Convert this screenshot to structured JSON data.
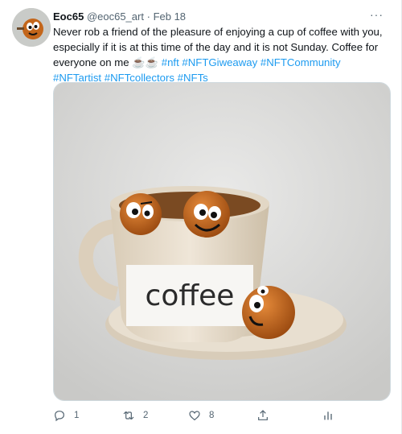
{
  "tweet": {
    "display_name": "Eoc65",
    "handle": "@eoc65_art",
    "separator": "·",
    "date": "Feb 18",
    "more_label": "···",
    "text_part1": "Never rob a friend of the pleasure of enjoying a cup of coffee with you, especially if it is at this time of the day and it is not Sunday. Coffee for everyone on me ",
    "emoji": "☕☕",
    "hashtags": [
      "#nft",
      "#NFTGiweaway",
      "#NFTCommunity",
      "#NFTartist",
      "#NFTcollectors",
      "#NFTs"
    ],
    "image_text": "coffee"
  },
  "actions": {
    "reply_count": "1",
    "retweet_count": "2",
    "like_count": "8"
  },
  "icons": {
    "reply": "reply-icon",
    "retweet": "retweet-icon",
    "like": "heart-icon",
    "share": "share-icon",
    "analytics": "analytics-icon"
  },
  "colors": {
    "link": "#1d9bf0",
    "secondary_text": "#536471",
    "cup": "#e8dfd0",
    "ball": "#c3661b"
  }
}
